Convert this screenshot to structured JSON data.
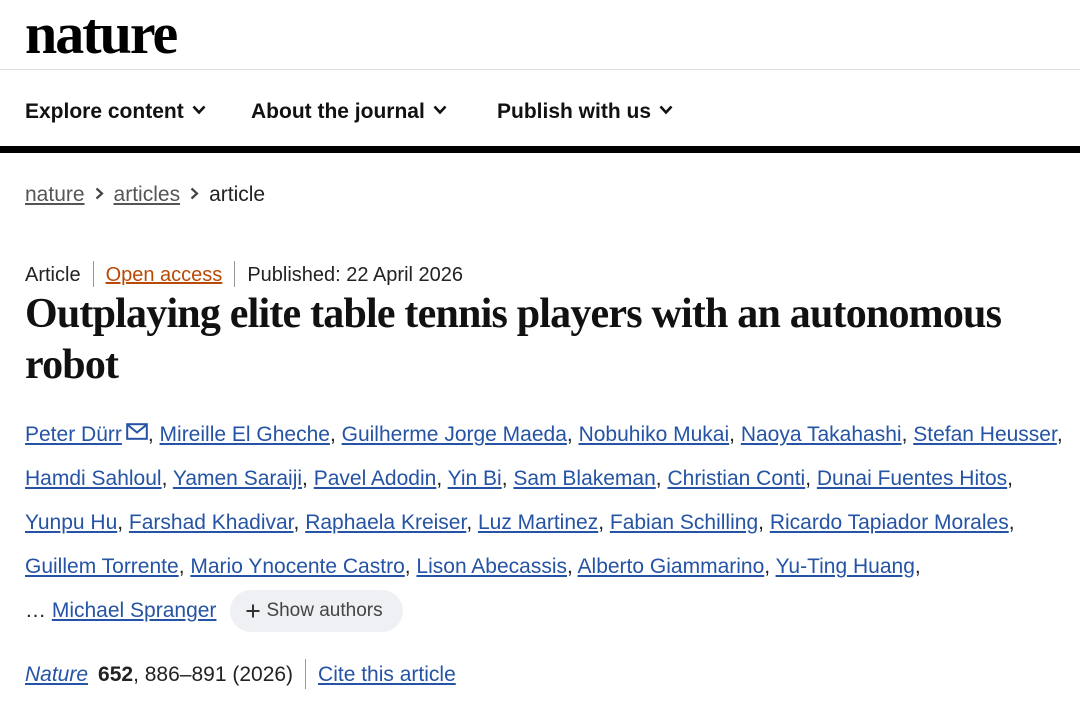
{
  "header": {
    "logo": "nature"
  },
  "nav": {
    "items": [
      {
        "label": "Explore content",
        "icon": "chevron-down-icon"
      },
      {
        "label": "About the journal",
        "icon": "chevron-down-icon"
      },
      {
        "label": "Publish with us",
        "icon": "chevron-down-icon"
      }
    ]
  },
  "breadcrumb": {
    "items": [
      "nature",
      "articles"
    ],
    "current": "article",
    "separator_icon": "chevron-right-icon"
  },
  "article": {
    "type": "Article",
    "access": "Open access",
    "published": "Published: 22 April 2026",
    "title": "Outplaying elite table tennis players with an autonomous robot",
    "authors": [
      "Peter Dürr",
      "Mireille El Gheche",
      "Guilherme Jorge Maeda",
      "Nobuhiko Mukai",
      "Naoya Takahashi",
      "Stefan Heusser",
      "Hamdi Sahloul",
      "Yamen Saraiji",
      "Pavel Adodin",
      "Yin Bi",
      "Sam Blakeman",
      "Christian Conti",
      "Dunai Fuentes Hitos",
      "Yunpu Hu",
      "Farshad Khadivar",
      "Raphaela Kreiser",
      "Luz Martinez",
      "Fabian Schilling",
      "Ricardo Tapiador Morales",
      "Guillem Torrente",
      "Mario Ynocente Castro",
      "Lison Abecassis",
      "Alberto Giammarino",
      "Yu-Ting Huang"
    ],
    "ellipsis": "…",
    "last_author": "Michael Spranger",
    "show_authors_label": "Show authors",
    "citation": {
      "journal": "Nature",
      "volume": "652",
      "pages_year": ", 886–891 (2026)",
      "cite_label": "Cite this article"
    }
  },
  "colors": {
    "link": "#2553a5",
    "open_access": "#b94a05",
    "nav_bar": "#000000",
    "button_bg": "#eef0f3"
  }
}
